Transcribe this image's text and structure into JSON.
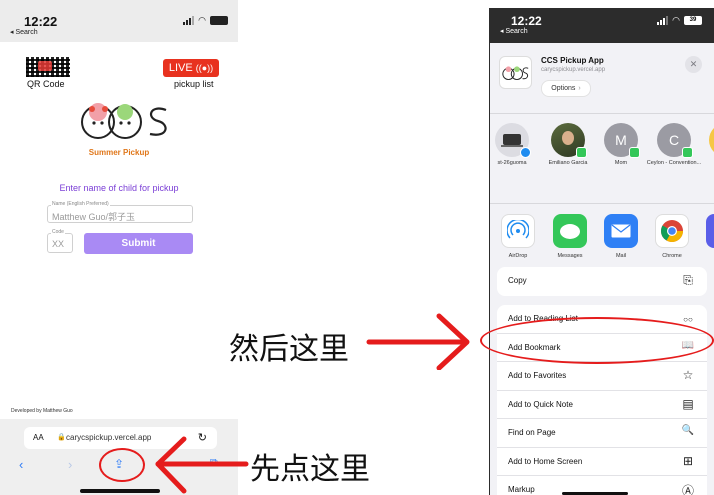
{
  "left_phone": {
    "status": {
      "time": "12:22",
      "back": "◂ Search"
    },
    "qr_label": "QR Code",
    "live": {
      "badge": "LIVE",
      "subtitle": "pickup list"
    },
    "logo_subtitle": "Summer Pickup",
    "prompt": "Enter name of child for pickup",
    "name_field": {
      "label": "Name (English Preferred)",
      "value": "Matthew Guo/郭子玉"
    },
    "code_field": {
      "label": "Code",
      "value": "XX"
    },
    "submit_label": "Submit",
    "developed_by": "Developed by Matthew Guo",
    "browser": {
      "aa": "AA",
      "url": "carycspickup.vercel.app"
    }
  },
  "annotations": {
    "then_here": "然后这里",
    "first_tap_here": "先点这里"
  },
  "right_phone": {
    "status": {
      "time": "12:22",
      "back": "◂ Search",
      "battery": "39"
    },
    "share_header": {
      "title": "CCS Pickup App",
      "url": "carycspickup.vercel.app",
      "options_label": "Options",
      "options_chevron": "›"
    },
    "people": [
      {
        "name": "st-26guoma",
        "kind": "device"
      },
      {
        "name": "Emiliano Garcia",
        "kind": "photo"
      },
      {
        "name": "Mom",
        "initial": "M"
      },
      {
        "name": "Ceylon - Convention...",
        "initial": "C"
      }
    ],
    "apps": [
      {
        "name": "AirDrop",
        "icon": "airdrop-icon",
        "color": "#1f8cf0"
      },
      {
        "name": "Messages",
        "icon": "messages-icon",
        "color": "#34c759"
      },
      {
        "name": "Mail",
        "icon": "mail-icon",
        "color": "#2f80f5"
      },
      {
        "name": "Chrome",
        "icon": "chrome-icon",
        "color": "#ffffff"
      }
    ],
    "actions_group1": [
      {
        "label": "Copy",
        "icon": "⎘"
      }
    ],
    "actions_group2": [
      {
        "label": "Add to Reading List",
        "icon": "○○"
      },
      {
        "label": "Add Bookmark",
        "icon": "📖"
      },
      {
        "label": "Add to Favorites",
        "icon": "☆"
      },
      {
        "label": "Add to Quick Note",
        "icon": "▤"
      },
      {
        "label": "Find on Page",
        "icon": "🔍"
      },
      {
        "label": "Add to Home Screen",
        "icon": "⊞"
      },
      {
        "label": "Markup",
        "icon": "Ⓐ"
      }
    ]
  },
  "colors": {
    "accent_red": "#e51c1c",
    "submit_purple": "#a98af4",
    "prompt_purple": "#7b3fd6",
    "logo_orange": "#e0771a"
  }
}
